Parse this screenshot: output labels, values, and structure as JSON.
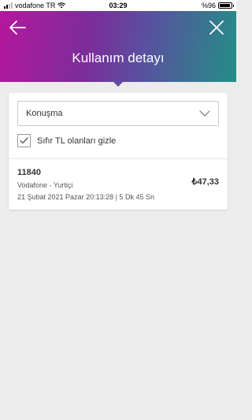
{
  "status_bar": {
    "carrier": "vodafone TR",
    "time": "03:29",
    "battery": "%96",
    "battery_level": 0.96
  },
  "header": {
    "title": "Kullanım detayı",
    "back_icon": "arrow-left-icon",
    "close_icon": "close-icon"
  },
  "filter": {
    "selected": "Konuşma",
    "hide_zero_label": "Sıfır TL olanları gizle",
    "hide_zero_checked": true
  },
  "usages": [
    {
      "number": "11840",
      "operator": "Vodafone - Yurtiçi",
      "datetime": "21 Şubat 2021 Pazar 20:13:28 | 5 Dk 45 Sn",
      "amount": "₺47,33"
    }
  ],
  "colors": {
    "gradient_start": "#b5179e",
    "gradient_mid": "#5a4fa0",
    "gradient_end": "#238f86",
    "background": "#ececec"
  }
}
